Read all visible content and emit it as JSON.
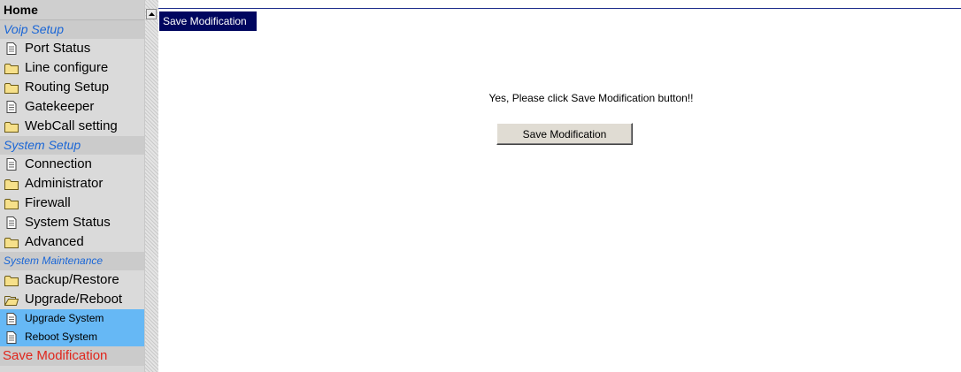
{
  "sidebar": {
    "home_label": "Home",
    "sections": [
      {
        "title": "Voip Setup",
        "items": [
          {
            "label": "Port Status",
            "icon": "page-icon"
          },
          {
            "label": "Line configure",
            "icon": "folder-icon"
          },
          {
            "label": "Routing Setup",
            "icon": "folder-icon"
          },
          {
            "label": "Gatekeeper",
            "icon": "page-icon"
          },
          {
            "label": "WebCall setting",
            "icon": "folder-icon"
          }
        ]
      },
      {
        "title": "System Setup",
        "items": [
          {
            "label": "Connection",
            "icon": "page-icon"
          },
          {
            "label": "Administrator",
            "icon": "folder-icon"
          },
          {
            "label": "Firewall",
            "icon": "folder-icon"
          },
          {
            "label": "System Status",
            "icon": "page-icon"
          },
          {
            "label": "Advanced",
            "icon": "folder-icon"
          }
        ]
      },
      {
        "title": "System Maintenance",
        "items": [
          {
            "label": "Backup/Restore",
            "icon": "folder-icon"
          },
          {
            "label": "Upgrade/Reboot",
            "icon": "open-folder-icon"
          }
        ],
        "subitems": [
          {
            "label": "Upgrade System",
            "icon": "page-icon"
          },
          {
            "label": "Reboot System",
            "icon": "page-icon"
          }
        ]
      }
    ],
    "save_modification_label": "Save Modification"
  },
  "main": {
    "title": "Save Modification",
    "prompt_text": "Yes, Please click Save Modification button!!",
    "button_label": "Save Modification"
  },
  "colors": {
    "sidebar_bg": "#d7d7d7",
    "section_text": "#1a66d6",
    "highlight": "#66b8f5",
    "title_bar": "#00065f",
    "save_link": "#e0261c"
  }
}
